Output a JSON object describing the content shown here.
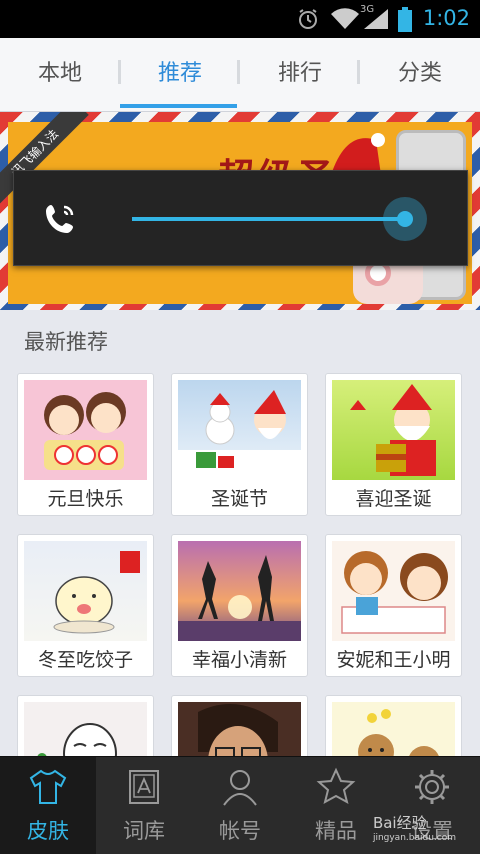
{
  "status_bar": {
    "time": "1:02",
    "network": "3G"
  },
  "tabs": [
    {
      "label": "本地",
      "active": false
    },
    {
      "label": "推荐",
      "active": true
    },
    {
      "label": "排行",
      "active": false
    },
    {
      "label": "分类",
      "active": false
    }
  ],
  "banner": {
    "ribbon": "讯飞输入法",
    "title": "超级圣诞"
  },
  "volume": {
    "icon": "phone-icon",
    "level": 0.94
  },
  "section": {
    "title": "最新推荐"
  },
  "skins": [
    {
      "label": "元旦快乐"
    },
    {
      "label": "圣诞节"
    },
    {
      "label": "喜迎圣诞"
    },
    {
      "label": "冬至吃饺子"
    },
    {
      "label": "幸福小清新"
    },
    {
      "label": "安妮和王小明"
    },
    {
      "label": ""
    },
    {
      "label": ""
    },
    {
      "label": ""
    }
  ],
  "bottom_nav": [
    {
      "label": "皮肤",
      "icon": "shirt-icon",
      "active": true
    },
    {
      "label": "词库",
      "icon": "dictionary-icon",
      "active": false
    },
    {
      "label": "帐号",
      "icon": "person-icon",
      "active": false
    },
    {
      "label": "精品",
      "icon": "star-icon",
      "active": false
    },
    {
      "label": "设置",
      "icon": "gear-icon",
      "active": false
    }
  ],
  "watermark": {
    "text": "Bai经验",
    "sub": "jingyan.baidu.com"
  },
  "colors": {
    "accent": "#33b5e5",
    "active_tab": "#2e8bd8",
    "nav_bg": "#2b2b2b"
  }
}
